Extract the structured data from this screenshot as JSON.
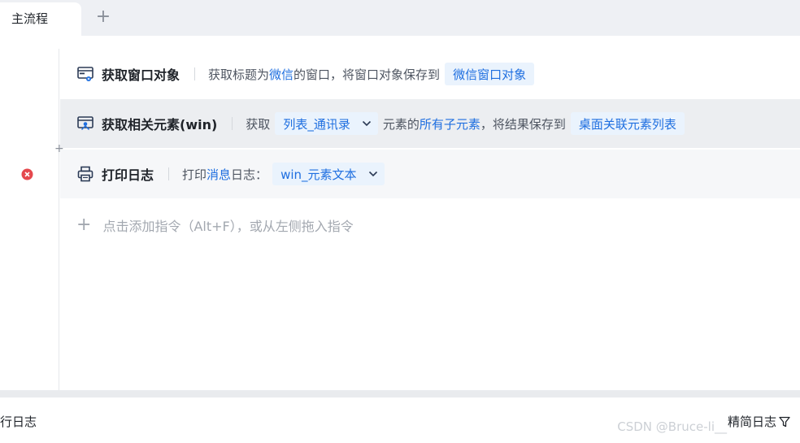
{
  "tabs": {
    "active_label": "主流程",
    "add_symbol": "+"
  },
  "rows": [
    {
      "name": "获取窗口对象",
      "desc_parts": [
        "获取标题为",
        "微信",
        "的窗口，将窗口对象保存到"
      ],
      "output_var": "微信窗口对象"
    },
    {
      "name": "获取相关元素(win)",
      "prefix": "获取",
      "element_select": "列表_通讯录",
      "mid_parts": [
        "元素的",
        "所有子元素",
        "，将结果保存到"
      ],
      "output_var": "桌面关联元素列表"
    },
    {
      "name": "打印日志",
      "prefix_parts": [
        "打印",
        "消息",
        "日志："
      ],
      "value_select": "win_元素文本"
    }
  ],
  "insert_plus": "+",
  "hint": {
    "plus": "+",
    "text": "点击添加指令（Alt+F），或从左侧拖入指令"
  },
  "log_panel": {
    "title": "行日志",
    "simple_log": "精简日志"
  },
  "watermark": "CSDN @Bruce-li__",
  "colors": {
    "accent": "#1f6fe0",
    "chip_bg": "#eaf3fd",
    "error": "#e5484d",
    "selected_row": "#eceef1"
  }
}
